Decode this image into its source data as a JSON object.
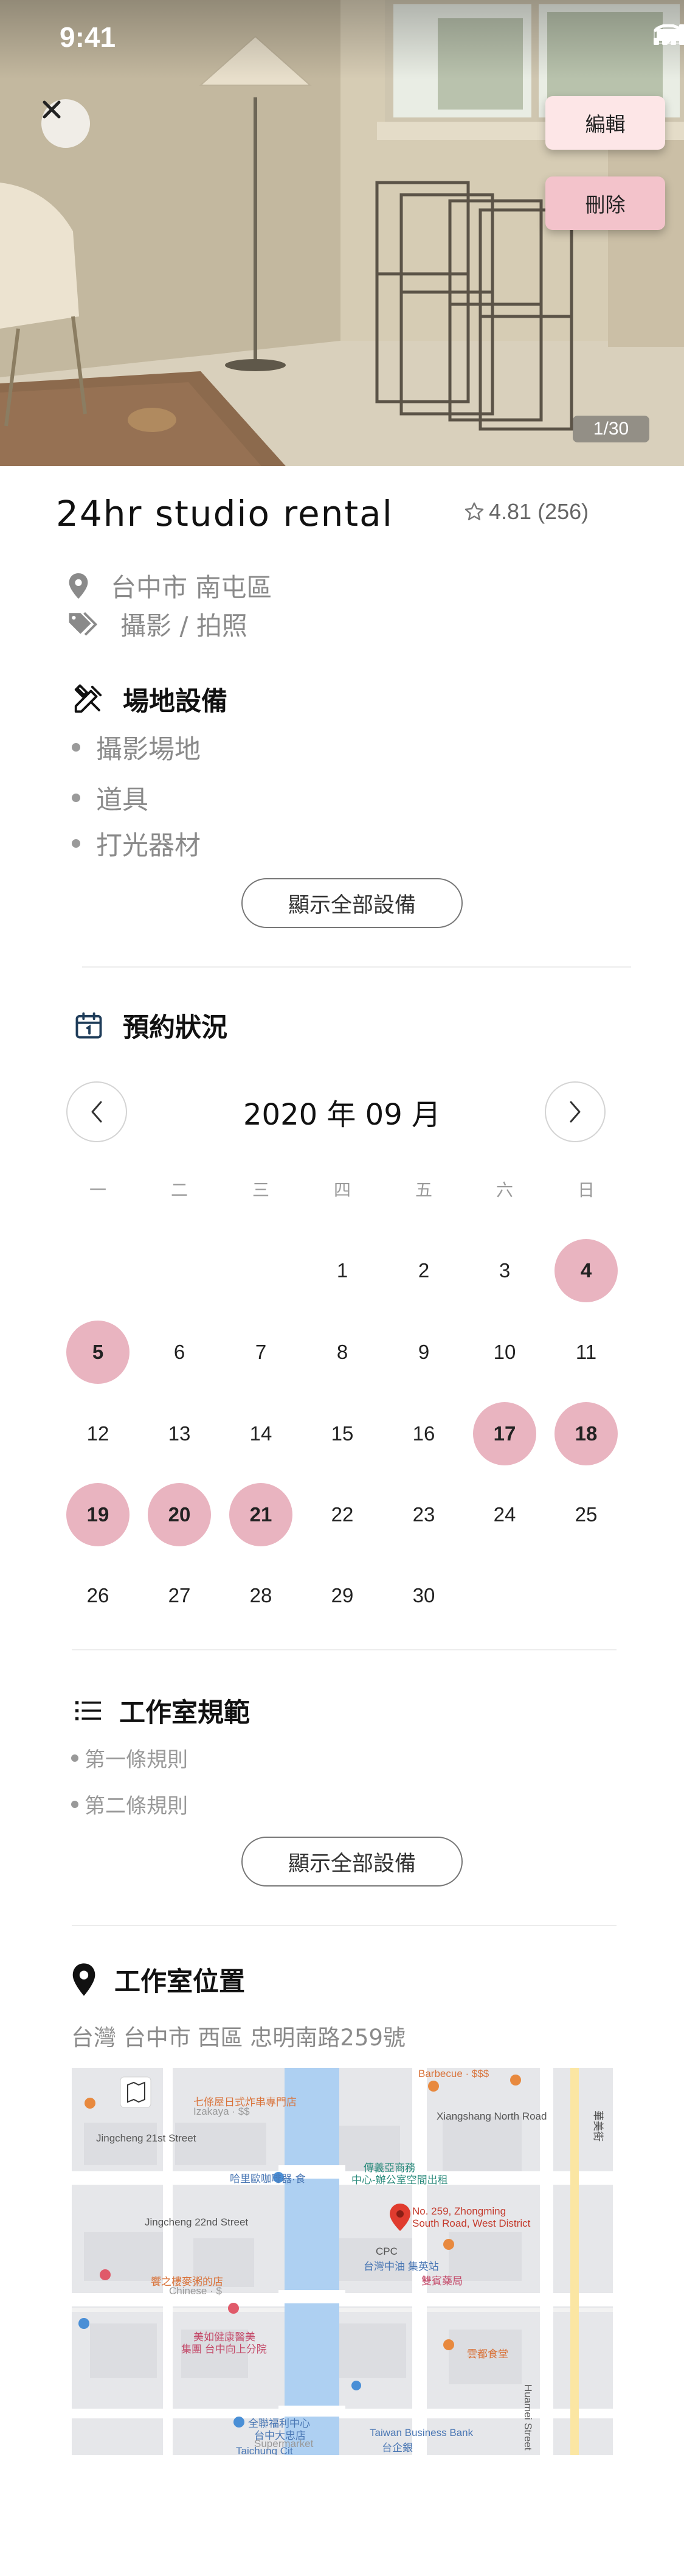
{
  "status_bar": {
    "time": "9:41"
  },
  "hero": {
    "edit_label": "編輯",
    "delete_label": "刪除",
    "photo_counter": "1/30"
  },
  "listing": {
    "title": "24hr studio rental",
    "rating": "4.81 (256)",
    "location": "台中市 南屯區",
    "category": "攝影 / 拍照"
  },
  "facilities": {
    "heading": "場地設備",
    "items": [
      "攝影場地",
      "道具",
      "打光器材"
    ],
    "show_all": "顯示全部設備"
  },
  "booking": {
    "heading": "預約狀況",
    "month_title": "2020 年 09 月",
    "weekdays": [
      "一",
      "二",
      "三",
      "四",
      "五",
      "六",
      "日"
    ],
    "first_weekday_index": 3,
    "days_in_month": 30,
    "booked_days": [
      4,
      5,
      17,
      18,
      19,
      20,
      21
    ],
    "booked_color": "#e9b4c0"
  },
  "rules": {
    "heading": "工作室規範",
    "items": [
      "第一條規則",
      "第二條規則"
    ],
    "show_all": "顯示全部設備"
  },
  "location_section": {
    "heading": "工作室位置",
    "address": "台灣 台中市 西區 忠明南路259號",
    "map_labels": {
      "shop1": "七條屋日式炸串專門店",
      "shop1_sub": "Izakaya · $$",
      "bbq": "Barbecue · $$$",
      "road1": "Xiangshang North Road",
      "street21": "Jingcheng 21st Street",
      "cafe": "哈里歐咖啡器·食",
      "cafe2": "傳義亞商務",
      "cafe2_sub": "中心-辦公室空間出租",
      "street22": "Jingcheng 22nd Street",
      "pin": "No. 259, Zhongming",
      "pin_sub": "South Road, West District",
      "cpc": "CPC",
      "cpc_sub": "台灣中油 集英站",
      "shop_chinese": "饗之樓麥粥的店",
      "chinese_sub": "Chinese · $",
      "pharmacy": "雙賓藥局",
      "beauty": "美如健康醫美",
      "beauty_sub": "集團 台中向上分院",
      "market": "全聯福利中心",
      "market_sub": "台中大忠店",
      "market_sub2": "Supermarket",
      "bank": "Taiwan Business Bank",
      "bank_sub": "台企銀",
      "restaurant": "雲都食堂",
      "huamei": "Huamei Street",
      "side": "華美街",
      "taicheng": "Taichung Cit"
    }
  }
}
